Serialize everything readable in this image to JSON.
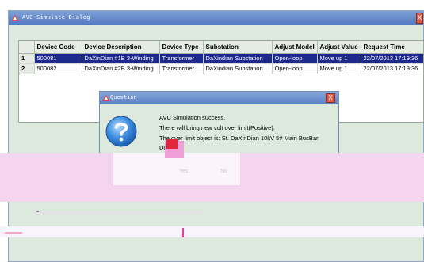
{
  "window": {
    "title": "AVC Simulate Dialog",
    "close_glyph": "X"
  },
  "table": {
    "columns": [
      "Device Code",
      "Device Description",
      "Device Type",
      "Substation",
      "Adjust Model",
      "Adjust Value",
      "Request Time"
    ],
    "rows": [
      {
        "num": "1",
        "selected": true,
        "cells": [
          "500081",
          "DaXinDian #1B 3-Winding",
          "Transformer",
          "DaXindian Substation",
          "Open-loop",
          "Move up 1",
          "22/07/2013 17:19:36"
        ]
      },
      {
        "num": "2",
        "selected": false,
        "cells": [
          "500082",
          "DaXinDian #2B 3-Winding",
          "Transformer",
          "DaXindian Substation",
          "Open-loop",
          "Move up 1",
          "22/07/2013 17:19:36"
        ]
      }
    ]
  },
  "dialog": {
    "title": "Question",
    "close_glyph": "X",
    "icon": "question-icon",
    "lines": [
      "AVC Simulation success.",
      "There will bring new volt over limit(Positive).",
      "The over limit object is: St. DaXinDian 10kV 5# Main BusBar",
      "Do"
    ],
    "yes_label": "Yes",
    "no_label": "No"
  },
  "colors": {
    "selection": "#1d2a8c",
    "window_bg": "#dce9dc",
    "title_blue": "#5a80c6",
    "close_red": "#d35b4c"
  }
}
